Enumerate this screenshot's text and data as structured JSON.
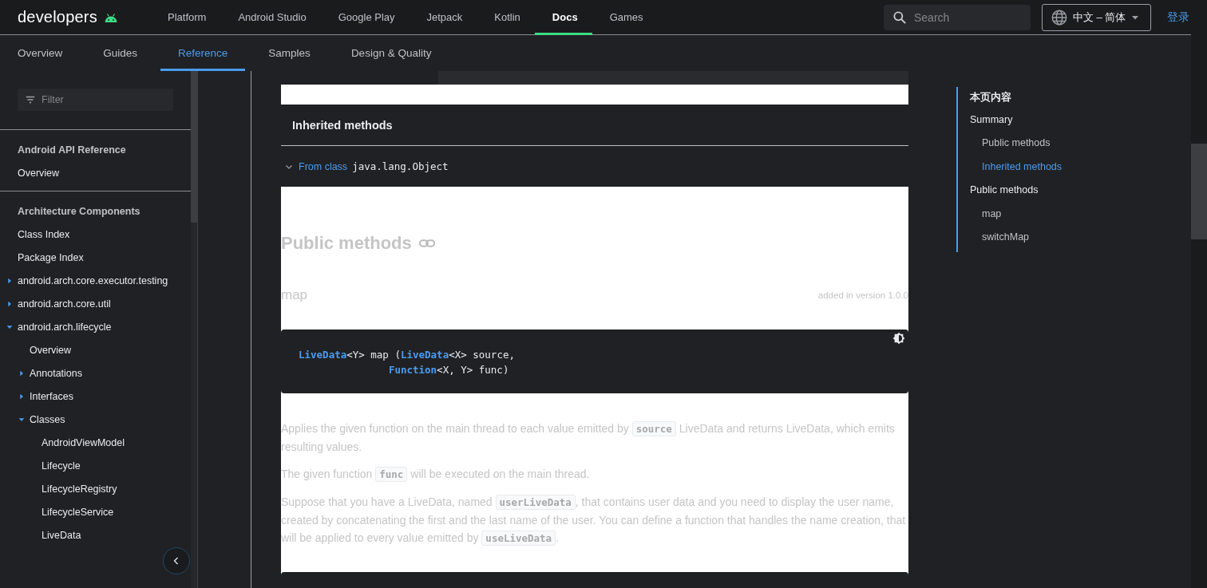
{
  "header": {
    "logo": "developers",
    "nav": [
      {
        "label": "Platform",
        "selected": false
      },
      {
        "label": "Android Studio",
        "selected": false
      },
      {
        "label": "Google Play",
        "selected": false
      },
      {
        "label": "Jetpack",
        "selected": false
      },
      {
        "label": "Kotlin",
        "selected": false
      },
      {
        "label": "Docs",
        "selected": true
      },
      {
        "label": "Games",
        "selected": false
      }
    ],
    "search": {
      "placeholder": "Search"
    },
    "language": "中文 – 简体",
    "sign_in": "登录"
  },
  "subnav": [
    {
      "label": "Overview",
      "selected": false
    },
    {
      "label": "Guides",
      "selected": false
    },
    {
      "label": "Reference",
      "selected": true
    },
    {
      "label": "Samples",
      "selected": false
    },
    {
      "label": "Design & Quality",
      "selected": false
    }
  ],
  "sidebar": {
    "filter": {
      "placeholder": "Filter"
    },
    "sections": [
      {
        "title": "Android API Reference",
        "items": [
          {
            "label": "Overview",
            "kind": "link"
          }
        ]
      },
      {
        "title": "Architecture Components",
        "items": [
          {
            "label": "Class Index",
            "kind": "link"
          },
          {
            "label": "Package Index",
            "kind": "link"
          },
          {
            "label": "android.arch.core.executor.testing",
            "kind": "group",
            "expanded": false
          },
          {
            "label": "android.arch.core.util",
            "kind": "group",
            "expanded": false
          },
          {
            "label": "android.arch.lifecycle",
            "kind": "group",
            "expanded": true,
            "children": [
              {
                "label": "Overview",
                "kind": "link"
              },
              {
                "label": "Annotations",
                "kind": "group",
                "expanded": false
              },
              {
                "label": "Interfaces",
                "kind": "group",
                "expanded": false
              },
              {
                "label": "Classes",
                "kind": "group",
                "expanded": true,
                "children": [
                  {
                    "label": "AndroidViewModel",
                    "kind": "link"
                  },
                  {
                    "label": "Lifecycle",
                    "kind": "link"
                  },
                  {
                    "label": "LifecycleRegistry",
                    "kind": "link"
                  },
                  {
                    "label": "LifecycleService",
                    "kind": "link"
                  },
                  {
                    "label": "LiveData",
                    "kind": "link"
                  }
                ]
              }
            ]
          }
        ]
      }
    ]
  },
  "content": {
    "inherited_methods": {
      "title": "Inherited methods",
      "rows": [
        {
          "prefix": "From class",
          "class_name": "java.lang.Object",
          "expanded": true
        }
      ]
    },
    "public_methods": {
      "title": "Public methods",
      "methods": [
        {
          "name": "map",
          "added": "added in version 1.0.0",
          "signature": [
            "**LiveData**<Y> map (**LiveData**<X> source,",
            "               **Function**<X, Y> func)"
          ],
          "paragraphs": [
            [
              {
                "text": "Applies the given function on the main thread to each value emitted by "
              },
              {
                "code": "source"
              },
              {
                "text": " LiveData and returns LiveData, which emits resulting values."
              }
            ],
            [
              {
                "text": "The given function "
              },
              {
                "code": "func"
              },
              {
                "text": " will be executed on the main thread."
              }
            ],
            [
              {
                "text": "Suppose that you have a LiveData, named "
              },
              {
                "code": "userLiveData"
              },
              {
                "text": ", that contains user data and you need to display the user name, created by concatenating the first and the last name of the user. You can define a function that handles the name creation, that will be applied to every value emitted by "
              },
              {
                "code": "useLiveData"
              },
              {
                "text": "."
              }
            ]
          ]
        }
      ]
    }
  },
  "toc": {
    "title": "本页内容",
    "items": [
      {
        "label": "Summary",
        "selected": false,
        "children": [
          {
            "label": "Public methods",
            "selected": false
          },
          {
            "label": "Inherited methods",
            "selected": true
          }
        ]
      },
      {
        "label": "Public methods",
        "selected": false,
        "children": [
          {
            "label": "map",
            "selected": false
          },
          {
            "label": "switchMap",
            "selected": false
          }
        ]
      }
    ]
  }
}
